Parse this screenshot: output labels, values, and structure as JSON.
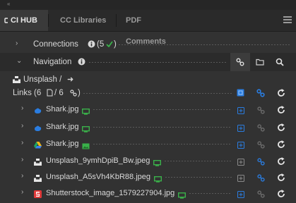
{
  "panel": {
    "collapse_glyph": "«",
    "tabs": [
      {
        "label": "CI HUB",
        "icon": "ci-hub-logo-icon"
      },
      {
        "label": "CC Libraries"
      },
      {
        "label": "PDF Comments"
      }
    ],
    "menu_icon": "hamburger-menu-icon"
  },
  "connections": {
    "label": "Connections",
    "count": "(5",
    "close_paren": ")",
    "status_icon": "green-check-icon"
  },
  "navigation": {
    "label": "Navigation",
    "tools": [
      "link-icon",
      "folder-icon",
      "search-icon"
    ]
  },
  "breadcrumb": {
    "path": "Unsplash /",
    "arrow": "➜"
  },
  "links_summary": {
    "label": "Links (6",
    "separator": "/ 6",
    "close_paren": ")"
  },
  "links": [
    {
      "name": "Shark.jpg",
      "source": "blue-cloud-icon",
      "status": "green"
    },
    {
      "name": "Shark.jpg",
      "source": "blue-cloud-icon",
      "status": "green"
    },
    {
      "name": "Shark.jpg",
      "source": "google-drive-icon",
      "status": "green-image"
    },
    {
      "name": "Unsplash_9ymhDpiB_Bw.jpeg",
      "source": "unsplash-icon",
      "status": "green"
    },
    {
      "name": "Unsplash_A5sVh4KbR88.jpeg",
      "source": "unsplash-icon",
      "status": "green"
    },
    {
      "name": "Shutterstock_image_1579227904.jpg",
      "source": "shutterstock-icon",
      "status": "green"
    }
  ],
  "colors": {
    "accent_blue": "#2a7de1",
    "status_green": "#3ab14a",
    "panel_bg": "#323232"
  }
}
